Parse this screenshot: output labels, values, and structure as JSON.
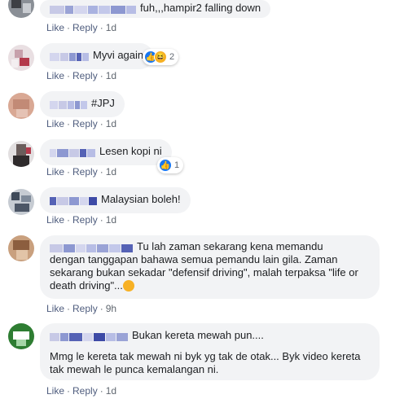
{
  "colors": {
    "bubble_bg": "#f2f3f5",
    "action_link": "#4f5d7e",
    "like_blue": "#1877f2",
    "haha_yellow": "#f7b125"
  },
  "comments": [
    {
      "text": "fuh,,,hampir2 falling down",
      "actions": {
        "like": "Like",
        "reply": "Reply",
        "time": "1d"
      }
    },
    {
      "text": "Myvi again",
      "actions": {
        "like": "Like",
        "reply": "Reply",
        "time": "1d"
      },
      "reactions": {
        "icons": [
          "like-icon",
          "haha-icon"
        ],
        "count": "2"
      }
    },
    {
      "text": "#JPJ",
      "actions": {
        "like": "Like",
        "reply": "Reply",
        "time": "1d"
      }
    },
    {
      "text": "Lesen kopi ni",
      "actions": {
        "like": "Like",
        "reply": "Reply",
        "time": "1d"
      },
      "reactions": {
        "icons": [
          "like-icon"
        ],
        "count": "1"
      }
    },
    {
      "text": "Malaysian boleh!",
      "actions": {
        "like": "Like",
        "reply": "Reply",
        "time": "1d"
      }
    },
    {
      "text_line1": "Tu lah zaman sekarang kena memandu",
      "text_line2": "dengan tanggapan bahawa semua pemandu lain gila. Zaman",
      "text_line3": "sekarang bukan sekadar \"defensif driving\", malah terpaksa \"life or",
      "text_line4": "death driving\"...",
      "emoji": "grinning-sweat-icon",
      "actions": {
        "like": "Like",
        "reply": "Reply",
        "time": "9h"
      }
    },
    {
      "text_line1": "Bukan kereta mewah pun....",
      "text_line2": "Mmg le kereta tak mewah ni byk yg tak de otak... Byk video kereta",
      "text_line3": "tak mewah le punca kemalangan ni.",
      "actions": {
        "like": "Like",
        "reply": "Reply",
        "time": "1d"
      }
    }
  ]
}
